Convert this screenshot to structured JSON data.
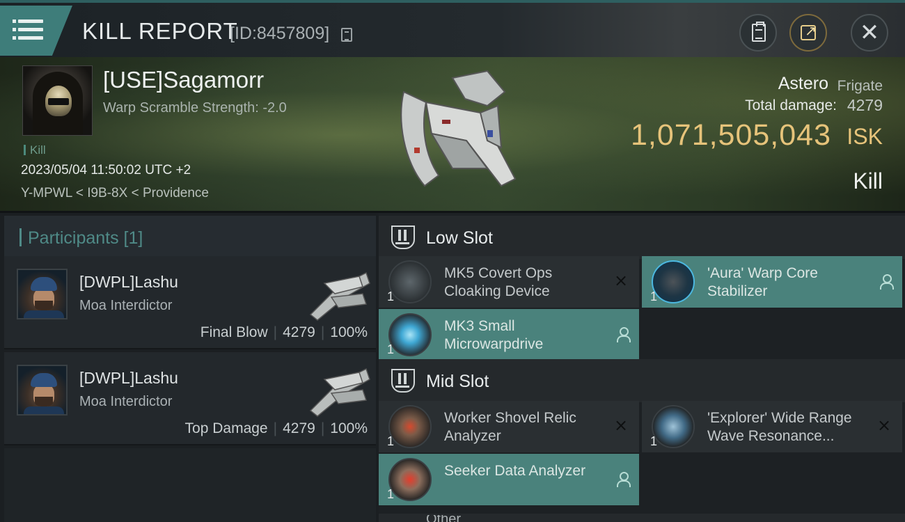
{
  "header": {
    "title": "KILL REPORT",
    "report_id": "[ID:8457809]"
  },
  "victim": {
    "name": "[USE]Sagamorr",
    "subtitle": "Warp Scramble Strength: -2.0",
    "tag": "Kill",
    "datetime": "2023/05/04 11:50:02 UTC +2",
    "location": "Y-MPWL < I9B-8X < Providence"
  },
  "ship": {
    "name": "Astero",
    "class": "Frigate",
    "total_damage_label": "Total damage:",
    "total_damage": "4279",
    "value": "1,071,505,043",
    "currency": "ISK",
    "result": "Kill"
  },
  "participants": {
    "header": "Participants [1]",
    "rows": [
      {
        "name": "[DWPL]Lashu",
        "ship": "Moa Interdictor",
        "role": "Final Blow",
        "damage": "4279",
        "percent": "100%"
      },
      {
        "name": "[DWPL]Lashu",
        "ship": "Moa Interdictor",
        "role": "Top Damage",
        "damage": "4279",
        "percent": "100%"
      }
    ]
  },
  "slots": {
    "low": {
      "title": "Low Slot",
      "modules": [
        {
          "name": "MK5 Covert Ops Cloaking Device",
          "qty": "1",
          "status": "destroyed",
          "icon": "cloak-module-icon"
        },
        {
          "name": "'Aura' Warp Core Stabilizer",
          "qty": "1",
          "status": "dropped",
          "icon": "warp-core-stabilizer-icon"
        },
        {
          "name": "MK3 Small Microwarpdrive",
          "qty": "1",
          "status": "dropped",
          "icon": "microwarpdrive-icon"
        }
      ]
    },
    "mid": {
      "title": "Mid Slot",
      "modules": [
        {
          "name": "Worker Shovel Relic Analyzer",
          "qty": "1",
          "status": "destroyed",
          "icon": "relic-analyzer-icon"
        },
        {
          "name": "'Explorer' Wide Range Wave Resonance...",
          "qty": "1",
          "status": "destroyed",
          "icon": "wave-resonance-icon"
        },
        {
          "name": "Seeker Data Analyzer",
          "qty": "1",
          "status": "dropped",
          "icon": "data-analyzer-icon"
        }
      ]
    },
    "next_peek": "Other"
  },
  "icons": {
    "destroyed": "×"
  },
  "colors": {
    "accent": "#4f8a87",
    "dropped_bg": "#4a827c",
    "isk": "#e6c37a"
  }
}
